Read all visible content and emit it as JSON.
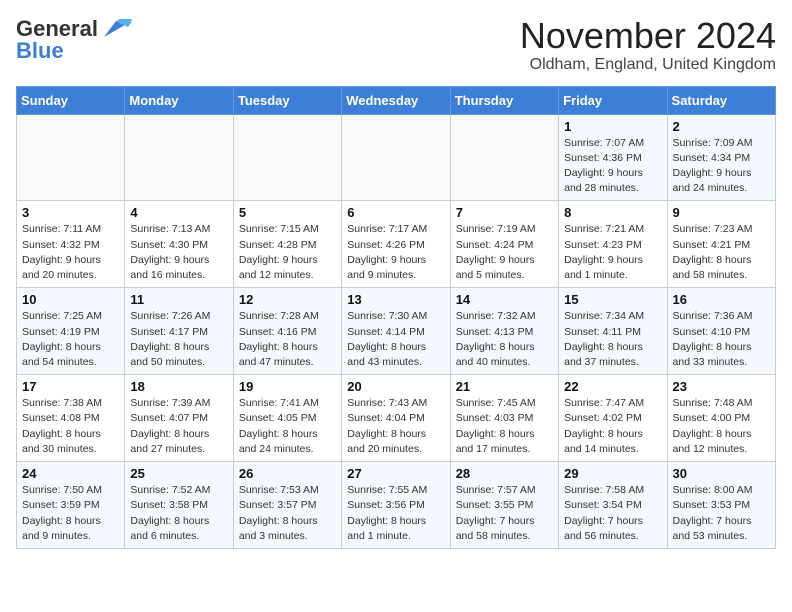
{
  "header": {
    "logo_general": "General",
    "logo_blue": "Blue",
    "month_title": "November 2024",
    "subtitle": "Oldham, England, United Kingdom"
  },
  "days_of_week": [
    "Sunday",
    "Monday",
    "Tuesday",
    "Wednesday",
    "Thursday",
    "Friday",
    "Saturday"
  ],
  "weeks": [
    [
      {
        "day": "",
        "info": ""
      },
      {
        "day": "",
        "info": ""
      },
      {
        "day": "",
        "info": ""
      },
      {
        "day": "",
        "info": ""
      },
      {
        "day": "",
        "info": ""
      },
      {
        "day": "1",
        "info": "Sunrise: 7:07 AM\nSunset: 4:36 PM\nDaylight: 9 hours and 28 minutes."
      },
      {
        "day": "2",
        "info": "Sunrise: 7:09 AM\nSunset: 4:34 PM\nDaylight: 9 hours and 24 minutes."
      }
    ],
    [
      {
        "day": "3",
        "info": "Sunrise: 7:11 AM\nSunset: 4:32 PM\nDaylight: 9 hours and 20 minutes."
      },
      {
        "day": "4",
        "info": "Sunrise: 7:13 AM\nSunset: 4:30 PM\nDaylight: 9 hours and 16 minutes."
      },
      {
        "day": "5",
        "info": "Sunrise: 7:15 AM\nSunset: 4:28 PM\nDaylight: 9 hours and 12 minutes."
      },
      {
        "day": "6",
        "info": "Sunrise: 7:17 AM\nSunset: 4:26 PM\nDaylight: 9 hours and 9 minutes."
      },
      {
        "day": "7",
        "info": "Sunrise: 7:19 AM\nSunset: 4:24 PM\nDaylight: 9 hours and 5 minutes."
      },
      {
        "day": "8",
        "info": "Sunrise: 7:21 AM\nSunset: 4:23 PM\nDaylight: 9 hours and 1 minute."
      },
      {
        "day": "9",
        "info": "Sunrise: 7:23 AM\nSunset: 4:21 PM\nDaylight: 8 hours and 58 minutes."
      }
    ],
    [
      {
        "day": "10",
        "info": "Sunrise: 7:25 AM\nSunset: 4:19 PM\nDaylight: 8 hours and 54 minutes."
      },
      {
        "day": "11",
        "info": "Sunrise: 7:26 AM\nSunset: 4:17 PM\nDaylight: 8 hours and 50 minutes."
      },
      {
        "day": "12",
        "info": "Sunrise: 7:28 AM\nSunset: 4:16 PM\nDaylight: 8 hours and 47 minutes."
      },
      {
        "day": "13",
        "info": "Sunrise: 7:30 AM\nSunset: 4:14 PM\nDaylight: 8 hours and 43 minutes."
      },
      {
        "day": "14",
        "info": "Sunrise: 7:32 AM\nSunset: 4:13 PM\nDaylight: 8 hours and 40 minutes."
      },
      {
        "day": "15",
        "info": "Sunrise: 7:34 AM\nSunset: 4:11 PM\nDaylight: 8 hours and 37 minutes."
      },
      {
        "day": "16",
        "info": "Sunrise: 7:36 AM\nSunset: 4:10 PM\nDaylight: 8 hours and 33 minutes."
      }
    ],
    [
      {
        "day": "17",
        "info": "Sunrise: 7:38 AM\nSunset: 4:08 PM\nDaylight: 8 hours and 30 minutes."
      },
      {
        "day": "18",
        "info": "Sunrise: 7:39 AM\nSunset: 4:07 PM\nDaylight: 8 hours and 27 minutes."
      },
      {
        "day": "19",
        "info": "Sunrise: 7:41 AM\nSunset: 4:05 PM\nDaylight: 8 hours and 24 minutes."
      },
      {
        "day": "20",
        "info": "Sunrise: 7:43 AM\nSunset: 4:04 PM\nDaylight: 8 hours and 20 minutes."
      },
      {
        "day": "21",
        "info": "Sunrise: 7:45 AM\nSunset: 4:03 PM\nDaylight: 8 hours and 17 minutes."
      },
      {
        "day": "22",
        "info": "Sunrise: 7:47 AM\nSunset: 4:02 PM\nDaylight: 8 hours and 14 minutes."
      },
      {
        "day": "23",
        "info": "Sunrise: 7:48 AM\nSunset: 4:00 PM\nDaylight: 8 hours and 12 minutes."
      }
    ],
    [
      {
        "day": "24",
        "info": "Sunrise: 7:50 AM\nSunset: 3:59 PM\nDaylight: 8 hours and 9 minutes."
      },
      {
        "day": "25",
        "info": "Sunrise: 7:52 AM\nSunset: 3:58 PM\nDaylight: 8 hours and 6 minutes."
      },
      {
        "day": "26",
        "info": "Sunrise: 7:53 AM\nSunset: 3:57 PM\nDaylight: 8 hours and 3 minutes."
      },
      {
        "day": "27",
        "info": "Sunrise: 7:55 AM\nSunset: 3:56 PM\nDaylight: 8 hours and 1 minute."
      },
      {
        "day": "28",
        "info": "Sunrise: 7:57 AM\nSunset: 3:55 PM\nDaylight: 7 hours and 58 minutes."
      },
      {
        "day": "29",
        "info": "Sunrise: 7:58 AM\nSunset: 3:54 PM\nDaylight: 7 hours and 56 minutes."
      },
      {
        "day": "30",
        "info": "Sunrise: 8:00 AM\nSunset: 3:53 PM\nDaylight: 7 hours and 53 minutes."
      }
    ]
  ]
}
